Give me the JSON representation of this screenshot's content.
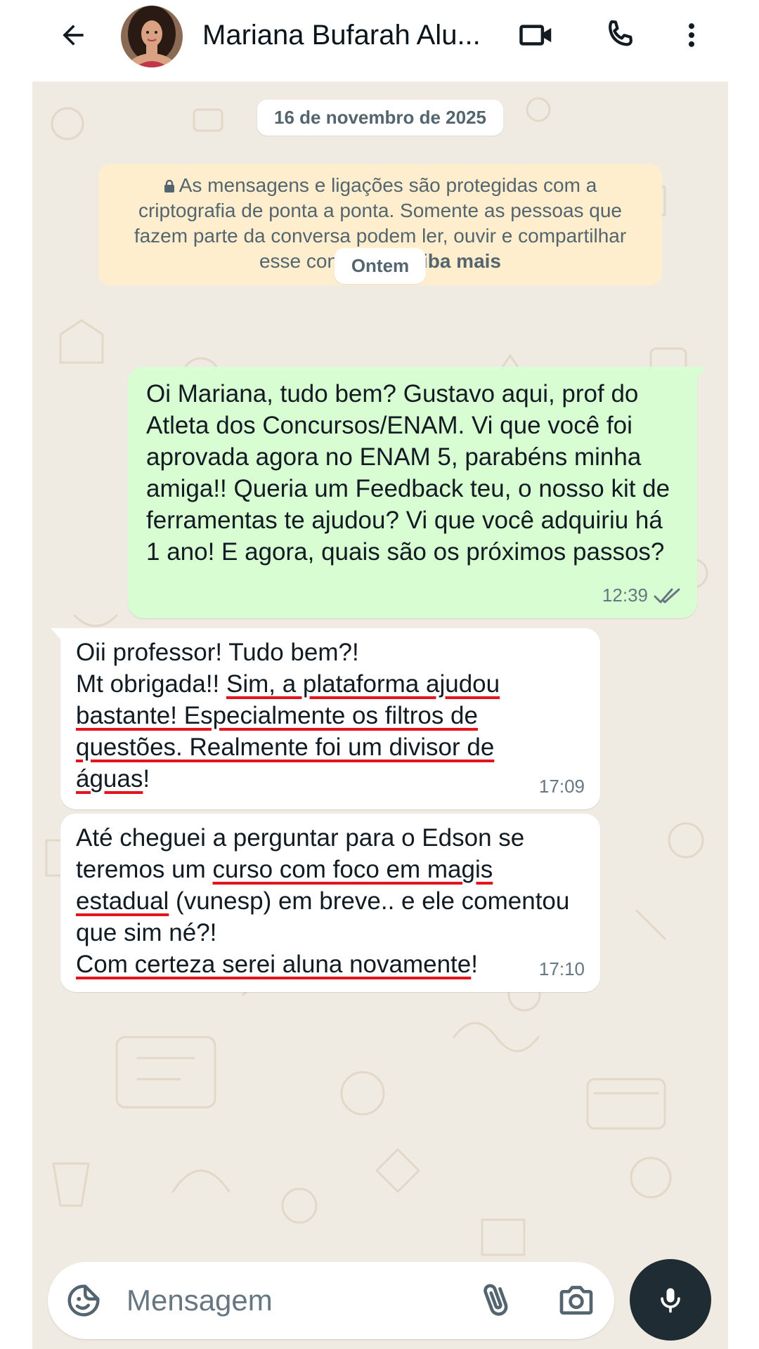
{
  "header": {
    "contact_name": "Mariana Bufarah Alu...",
    "icons": [
      "back-arrow-icon",
      "avatar",
      "video-call-icon",
      "phone-icon",
      "more-options-icon"
    ]
  },
  "chat": {
    "date_pill": "16 de novembro de 2025",
    "encryption_notice": {
      "text": "As mensagens e ligações são protegidas com a criptografia de ponta a ponta. Somente as pessoas que fazem parte da conversa podem ler, ouvir e compartilhar esse conteúdo.",
      "link": "Saiba mais"
    },
    "day_pill": "Ontem",
    "messages": [
      {
        "direction": "outgoing",
        "text": "Oi Mariana, tudo bem? Gustavo aqui, prof do Atleta dos Concursos/ENAM. Vi que você foi aprovada agora no ENAM 5, parabéns minha amiga!! Queria um Feedback teu, o nosso kit de ferramentas te ajudou? Vi que você adquiriu há 1 ano! E agora, quais são os próximos passos?",
        "time": "12:39",
        "status": "read"
      },
      {
        "direction": "incoming",
        "line1": "Oii professor! Tudo bem?!",
        "pre": "Mt obrigada!! ",
        "highlight": "Sim, a plataforma ajudou bastante! Especialmente os filtros de questões. Realmente foi um divisor de águas",
        "post": "!",
        "time": "17:09"
      },
      {
        "direction": "incoming",
        "pre": "Até cheguei a perguntar para o Edson se teremos um ",
        "highlight1": "curso com foco em magis estadual",
        "mid": " (vunesp) em breve.. e ele comentou que sim né?!",
        "highlight2": "Com certeza serei aluna novamente",
        "post": "!",
        "time": "17:10"
      }
    ]
  },
  "composer": {
    "placeholder": "Mensagem",
    "icons": [
      "sticker-icon",
      "attach-icon",
      "camera-icon",
      "microphone-icon"
    ]
  },
  "colors": {
    "wallpaper": "#efeae2",
    "outgoing_bubble": "#d9fdd3",
    "incoming_bubble": "#ffffff",
    "encryption_bg": "#ffeecd",
    "underline": "#e3141b",
    "mic_button": "#1f2c34"
  }
}
